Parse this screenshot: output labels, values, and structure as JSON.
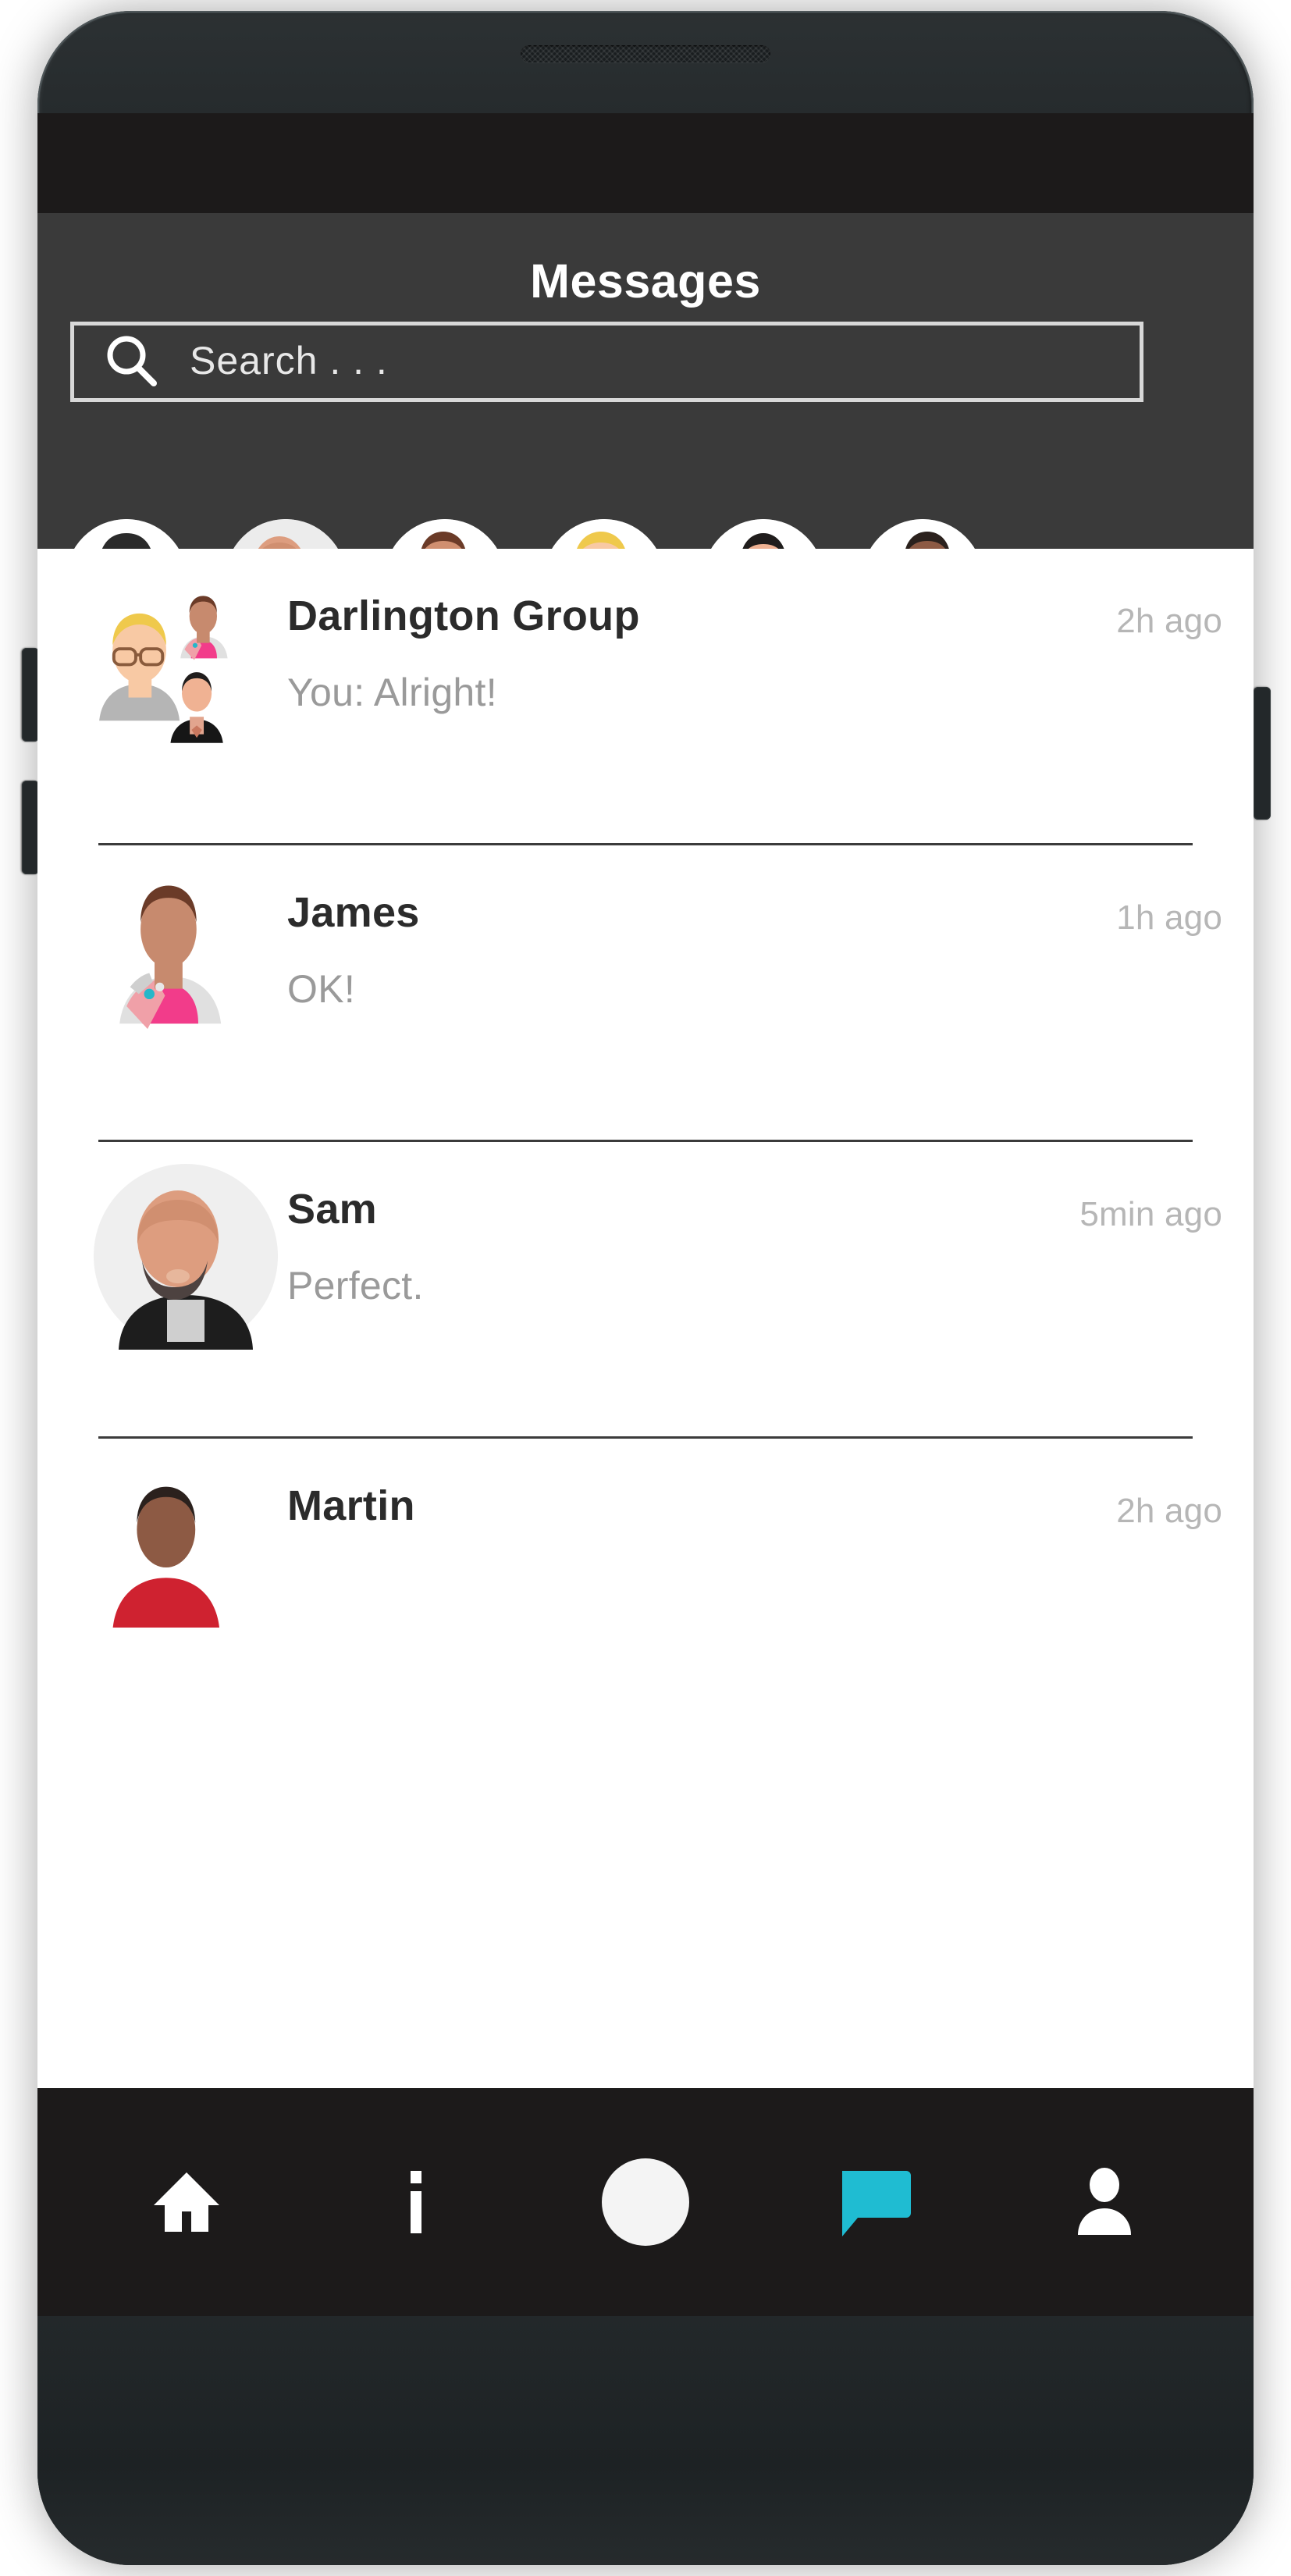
{
  "app": {
    "title": "Messages"
  },
  "search": {
    "placeholder": "Search . . .",
    "value": "",
    "icon": "search-icon"
  },
  "stories": [
    {
      "name": "story-1",
      "status": "busy",
      "status_color": "#ef2b2b"
    },
    {
      "name": "story-2",
      "status": "online",
      "status_color": "#22d127"
    },
    {
      "name": "story-3",
      "status": "online",
      "status_color": "#22d127"
    },
    {
      "name": "story-4",
      "status": "online",
      "status_color": "#22d127"
    },
    {
      "name": "story-5",
      "status": "busy",
      "status_color": "#ef2b2b"
    },
    {
      "name": "story-6",
      "status": "busy",
      "status_color": "#ef2b2b"
    }
  ],
  "conversations": [
    {
      "name": "Darlington Group",
      "preview": "You: Alright!",
      "time": "2h ago",
      "avatar_type": "group"
    },
    {
      "name": "James",
      "preview": "OK!",
      "time": "1h ago",
      "avatar_type": "james"
    },
    {
      "name": "Sam",
      "preview": "Perfect.",
      "time": "5min ago",
      "avatar_type": "sam"
    },
    {
      "name": "Martin",
      "preview": "",
      "time": "2h ago",
      "avatar_type": "martin"
    }
  ],
  "bottom_nav": [
    {
      "icon": "home-icon",
      "label": "Home",
      "active": false,
      "color": "#ffffff"
    },
    {
      "icon": "info-icon",
      "label": "Info",
      "active": false,
      "color": "#ffffff"
    },
    {
      "icon": "camera-circle-icon",
      "label": "Capture",
      "active": false,
      "color": "#f4f4f4"
    },
    {
      "icon": "chat-bubble-icon",
      "label": "Messages",
      "active": true,
      "color": "#1fbcd2"
    },
    {
      "icon": "person-icon",
      "label": "Profile",
      "active": false,
      "color": "#ffffff"
    }
  ],
  "theme": {
    "header_bg": "#3a3a3a",
    "status_bar_bg": "#1c1a1a",
    "nav_bg": "#1c1a1a",
    "accent": "#1fbcd2",
    "online": "#22d127",
    "busy": "#ef2b2b",
    "list_bg": "#ffffff",
    "divider": "#3b3b3b"
  }
}
